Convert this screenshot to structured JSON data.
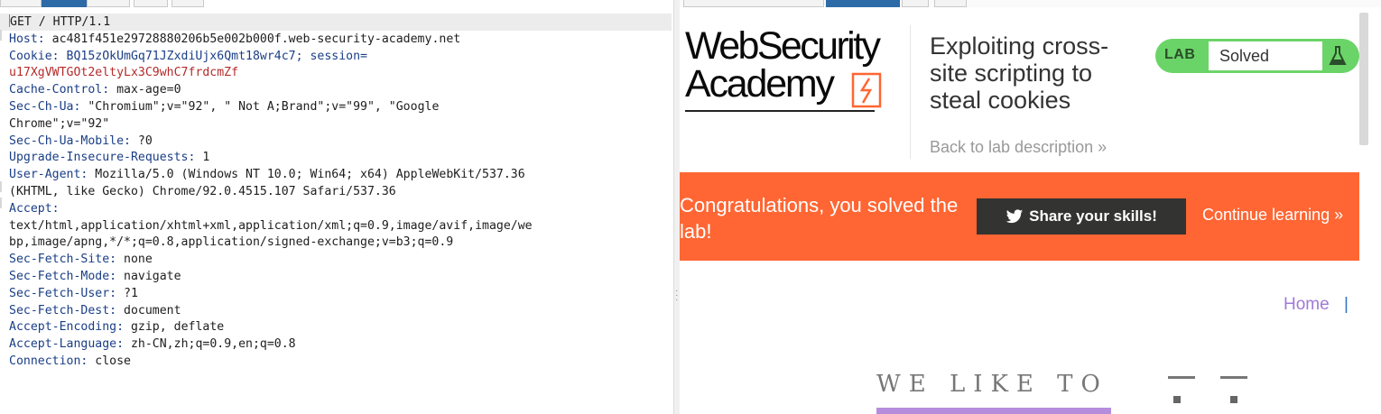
{
  "request": {
    "lines": [
      {
        "name": "GET / HTTP/1.1",
        "value": ""
      },
      {
        "name": "Host:",
        "value": " ac481f451e29728880206b5e002b000f.web-security-academy.net"
      },
      {
        "name": "Cookie:",
        "value": " BQ15zOkUmGq71JZxdiUjx6Qmt18wr4c7; session="
      },
      {
        "name": "",
        "value": "u17XgVWTGOt2eltyLx3C9whC7frdcmZf"
      },
      {
        "name": "Cache-Control:",
        "value": " max-age=0"
      },
      {
        "name": "Sec-Ch-Ua:",
        "value": " \"Chromium\";v=\"92\", \" Not A;Brand\";v=\"99\", \"Google"
      },
      {
        "name": "",
        "value": "Chrome\";v=\"92\""
      },
      {
        "name": "Sec-Ch-Ua-Mobile:",
        "value": " ?0"
      },
      {
        "name": "Upgrade-Insecure-Requests:",
        "value": " 1"
      },
      {
        "name": "User-Agent:",
        "value": " Mozilla/5.0 (Windows NT 10.0; Win64; x64) AppleWebKit/537.36"
      },
      {
        "name": "",
        "value": "(KHTML, like Gecko) Chrome/92.0.4515.107 Safari/537.36"
      },
      {
        "name": "Accept:",
        "value": ""
      },
      {
        "name": "",
        "value": "text/html,application/xhtml+xml,application/xml;q=0.9,image/avif,image/we"
      },
      {
        "name": "",
        "value": "bp,image/apng,*/*;q=0.8,application/signed-exchange;v=b3;q=0.9"
      },
      {
        "name": "Sec-Fetch-Site:",
        "value": " none"
      },
      {
        "name": "Sec-Fetch-Mode:",
        "value": " navigate"
      },
      {
        "name": "Sec-Fetch-User:",
        "value": " ?1"
      },
      {
        "name": "Sec-Fetch-Dest:",
        "value": " document"
      },
      {
        "name": "Accept-Encoding:",
        "value": " gzip, deflate"
      },
      {
        "name": "Accept-Language:",
        "value": " zh-CN,zh;q=0.9,en;q=0.8"
      },
      {
        "name": "Connection:",
        "value": " close"
      }
    ]
  },
  "render": {
    "logo": {
      "line1": "WebSecurity",
      "line2": "Academy"
    },
    "lab_title": "Exploiting cross-site scripting to steal cookies",
    "back_link": "Back to lab description »",
    "lab_badge": {
      "label": "LAB",
      "status": "Solved"
    },
    "banner": {
      "message": "Congratulations, you solved the lab!",
      "share_button": "Share your skills!",
      "continue_link": "Continue learning »"
    },
    "nav": {
      "home": "Home",
      "separator": "|"
    },
    "hero": {
      "text": "WE LIKE TO"
    },
    "colors": {
      "banner": "#ff6633",
      "badge_green": "#6bd468",
      "share_button": "#333332",
      "home_link": "#a07ad6",
      "header_name": "#1a3e86",
      "session_value": "#b52a2a"
    }
  }
}
